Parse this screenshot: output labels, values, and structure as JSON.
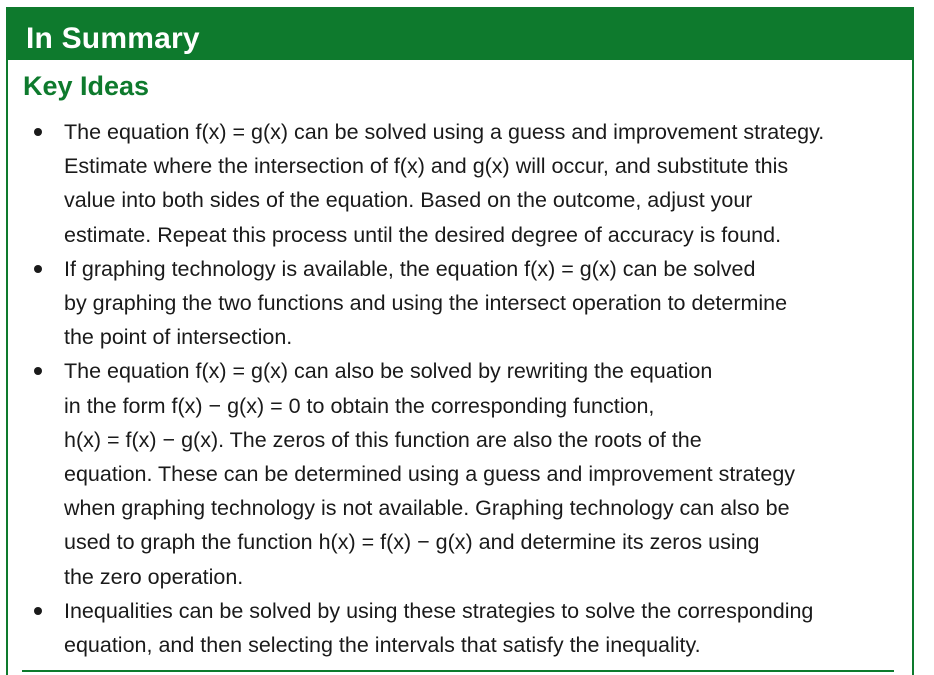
{
  "header": {
    "title": "In Summary"
  },
  "section": {
    "title": "Key Ideas"
  },
  "bullets": [
    {
      "lines": [
        "The equation f(x) = g(x) can be solved using a guess and improvement strategy.",
        "Estimate where the intersection of f(x) and g(x) will occur, and substitute this",
        "value into both sides of the equation. Based on the outcome, adjust your",
        "estimate. Repeat this process until the desired degree of accuracy is found."
      ]
    },
    {
      "lines": [
        "If graphing technology is available, the equation f(x) = g(x) can be solved",
        "by graphing the two functions and using the intersect operation to determine",
        "the point of intersection."
      ]
    },
    {
      "lines": [
        "The equation f(x) = g(x) can also be solved by rewriting the equation",
        "in the form f(x) − g(x) = 0 to obtain the corresponding function,",
        "h(x) = f(x) − g(x). The zeros of this function are also the roots of the",
        "equation. These can be determined using a guess and improvement strategy",
        "when graphing technology is not available. Graphing technology can also be",
        "used to graph the function h(x) = f(x) − g(x) and determine its zeros using",
        "the zero operation."
      ]
    },
    {
      "lines": [
        "Inequalities can be solved by using these strategies to solve the corresponding",
        "equation, and then selecting the intervals that satisfy the inequality."
      ]
    }
  ],
  "colors": {
    "accent": "#0e7a2d",
    "text": "#1a1a1a",
    "background": "#ffffff"
  }
}
